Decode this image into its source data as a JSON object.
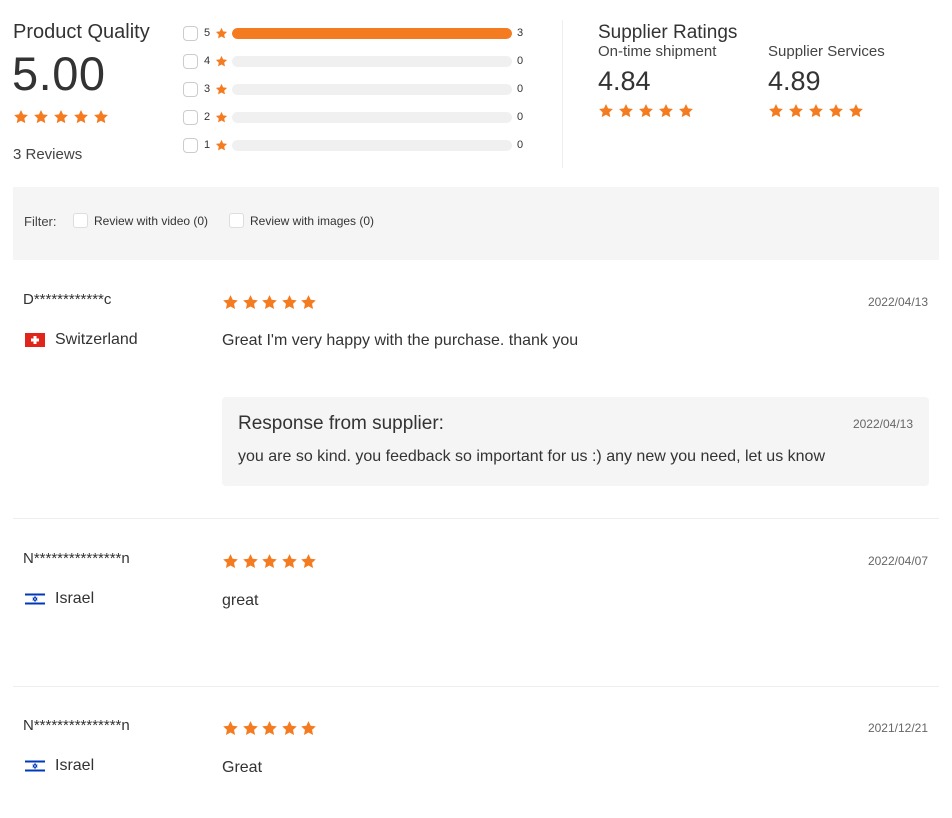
{
  "summary": {
    "title": "Product Quality",
    "score": "5.00",
    "rating_stars": 5,
    "reviews_text": "3 Reviews"
  },
  "distribution": [
    {
      "stars": "5",
      "count": "3",
      "fraction": 1.0
    },
    {
      "stars": "4",
      "count": "0",
      "fraction": 0.0
    },
    {
      "stars": "3",
      "count": "0",
      "fraction": 0.0
    },
    {
      "stars": "2",
      "count": "0",
      "fraction": 0.0
    },
    {
      "stars": "1",
      "count": "0",
      "fraction": 0.0
    }
  ],
  "supplier": {
    "title": "Supplier Ratings",
    "items": [
      {
        "label": "On-time shipment",
        "value": "4.84",
        "stars": 5
      },
      {
        "label": "Supplier Services",
        "value": "4.89",
        "stars": 5
      }
    ]
  },
  "filter": {
    "label": "Filter:",
    "options": [
      {
        "label": "Review with video (0)",
        "checked": false
      },
      {
        "label": "Review with images (0)",
        "checked": false
      }
    ]
  },
  "reviews": [
    {
      "name": "D************c",
      "country": "Switzerland",
      "flag": "switzerland-flag",
      "stars": 5,
      "date": "2022/04/13",
      "text": "Great I'm very happy with the purchase. thank you",
      "response": {
        "title": "Response from supplier:",
        "date": "2022/04/13",
        "text": "you are so kind. you feedback so important for us :) any new you need, let us know"
      }
    },
    {
      "name": "N***************n",
      "country": "Israel",
      "flag": "israel-flag",
      "stars": 5,
      "date": "2022/04/07",
      "text": "great"
    },
    {
      "name": "N***************n",
      "country": "Israel",
      "flag": "israel-flag",
      "stars": 5,
      "date": "2021/12/21",
      "text": "Great"
    }
  ],
  "colors": {
    "accent": "#f47b20",
    "bar_track": "#f0f0f0",
    "panel_bg": "#f5f5f5"
  }
}
